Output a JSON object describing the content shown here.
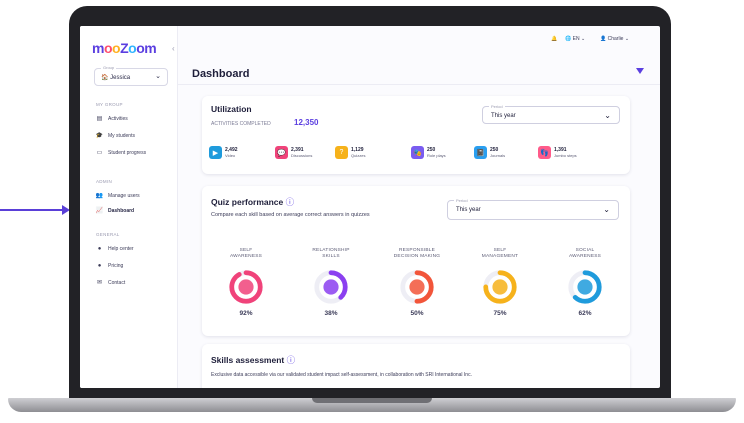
{
  "sidebar": {
    "logo": "mooZoom",
    "group_label": "Group",
    "group_value": "Jessica",
    "sections": [
      {
        "title": "MY GROUP",
        "items": [
          "Activities",
          "My students",
          "Student progress"
        ]
      },
      {
        "title": "ADMIN",
        "items": [
          "Manage users",
          "Dashboard"
        ]
      },
      {
        "title": "GENERAL",
        "items": [
          "Help center",
          "Pricing",
          "Contact"
        ]
      }
    ]
  },
  "topbar": {
    "language": "EN",
    "user": "Charlie"
  },
  "page": {
    "title": "Dashboard"
  },
  "utilization": {
    "title": "Utilization",
    "activities_label": "ACTIVITIES COMPLETED",
    "activities_value": "12,350",
    "period_label": "Period",
    "period_value": "This year",
    "stats": [
      {
        "value": "2,492",
        "name": "Video",
        "color": "#1f9bdc"
      },
      {
        "value": "2,391",
        "name": "Discussions",
        "color": "#f0437a"
      },
      {
        "value": "1,129",
        "name": "Quizzes",
        "color": "#f6b21b"
      },
      {
        "value": "250",
        "name": "Role plays",
        "color": "#7a5cf0"
      },
      {
        "value": "250",
        "name": "Journals",
        "color": "#2a9ff0"
      },
      {
        "value": "1,391",
        "name": "Jumbo steps",
        "color": "#ff5b8a"
      }
    ]
  },
  "quiz": {
    "title": "Quiz performance",
    "subtitle": "Compare each skill based on average correct answers in quizzes",
    "period_label": "Period",
    "period_value": "This year",
    "skills": [
      {
        "line1": "SELF",
        "line2": "AWARENESS",
        "pct": "92%",
        "value": 92,
        "color": "#f0437a"
      },
      {
        "line1": "RELATIONSHIP",
        "line2": "SKILLS",
        "pct": "38%",
        "value": 38,
        "color": "#8b3ff0"
      },
      {
        "line1": "RESPONSIBLE",
        "line2": "DECISION MAKING",
        "pct": "50%",
        "value": 50,
        "color": "#f2553a"
      },
      {
        "line1": "SELF",
        "line2": "MANAGEMENT",
        "pct": "75%",
        "value": 75,
        "color": "#f6b21b"
      },
      {
        "line1": "SOCIAL",
        "line2": "AWARENESS",
        "pct": "62%",
        "value": 62,
        "color": "#1f9bdc"
      }
    ]
  },
  "skills_assessment": {
    "title": "Skills assessment",
    "subtitle": "Exclusive data accessible via our validated student impact self-assessment, in collaboration with SRI International Inc."
  }
}
